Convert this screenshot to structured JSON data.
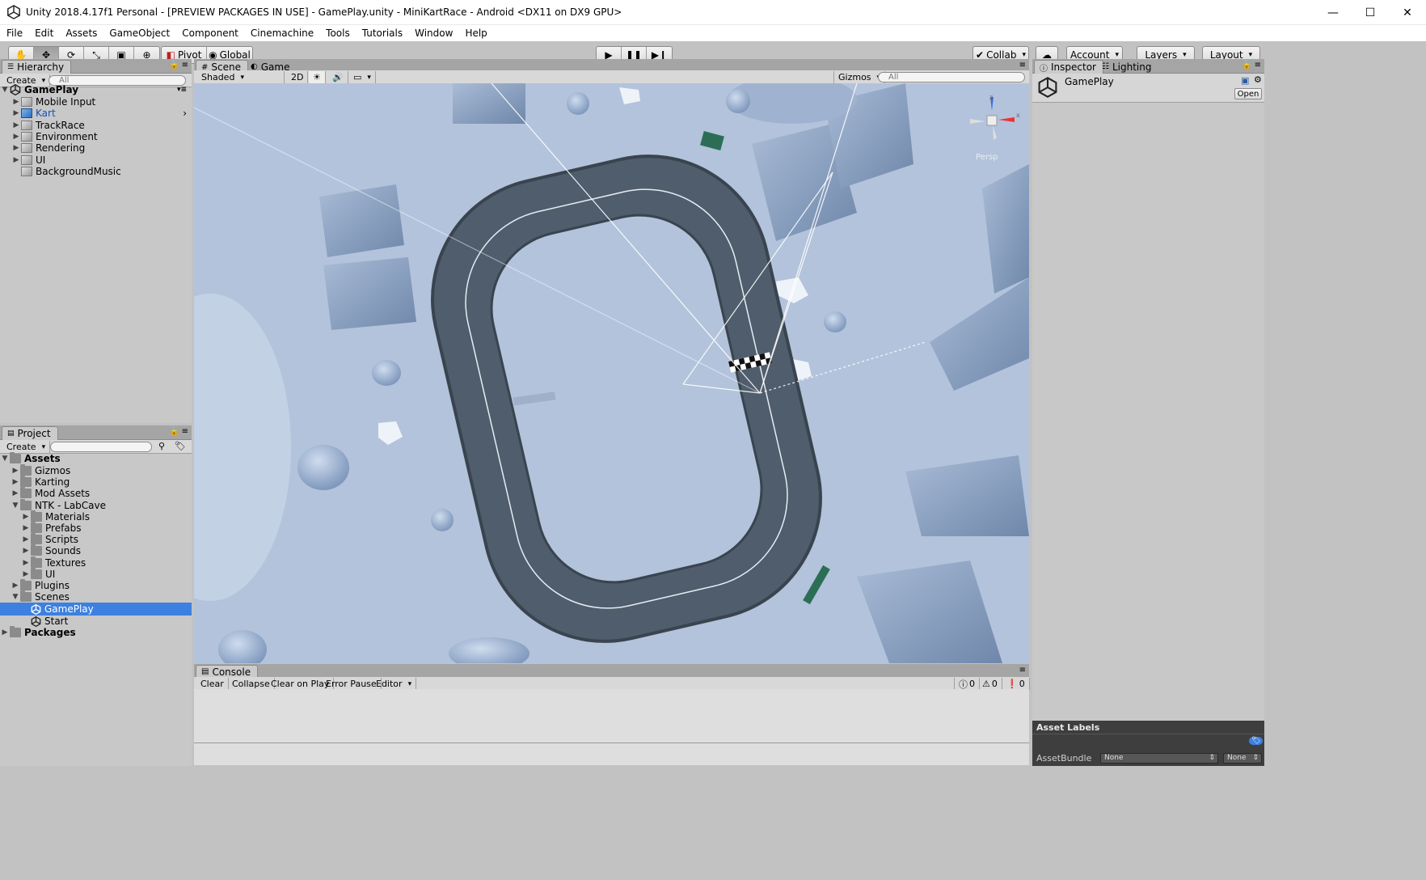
{
  "window": {
    "title": "Unity 2018.4.17f1 Personal - [PREVIEW PACKAGES IN USE] - GamePlay.unity - MiniKartRace - Android <DX11 on DX9 GPU>",
    "minimize": "—",
    "maximize": "☐",
    "close": "✕"
  },
  "menu": [
    "File",
    "Edit",
    "Assets",
    "GameObject",
    "Component",
    "Cinemachine",
    "Tools",
    "Tutorials",
    "Window",
    "Help"
  ],
  "toolbar": {
    "pivot": "Pivot",
    "global": "Global",
    "collab": "Collab",
    "account": "Account",
    "layers": "Layers",
    "layout": "Layout"
  },
  "hierarchy": {
    "tab": "Hierarchy",
    "create": "Create",
    "search_placeholder": "All",
    "scene": "GamePlay",
    "items": [
      {
        "label": "Mobile Input",
        "expandable": true,
        "color": "#000000"
      },
      {
        "label": "Kart",
        "expandable": true,
        "color": "#1a4fb0"
      },
      {
        "label": "TrackRace",
        "expandable": true,
        "color": "#000000"
      },
      {
        "label": "Environment",
        "expandable": true,
        "color": "#000000"
      },
      {
        "label": "Rendering",
        "expandable": true,
        "color": "#000000"
      },
      {
        "label": "UI",
        "expandable": true,
        "color": "#000000"
      },
      {
        "label": "BackgroundMusic",
        "expandable": false,
        "color": "#000000"
      }
    ]
  },
  "project": {
    "tab": "Project",
    "create": "Create",
    "assets_root": "Assets",
    "items": [
      {
        "label": "Gizmos",
        "depth": 1,
        "arrow": "▶"
      },
      {
        "label": "Karting",
        "depth": 1,
        "arrow": "▶"
      },
      {
        "label": "Mod Assets",
        "depth": 1,
        "arrow": "▶"
      },
      {
        "label": "NTK - LabCave",
        "depth": 1,
        "arrow": "▼"
      },
      {
        "label": "Materials",
        "depth": 2,
        "arrow": "▶"
      },
      {
        "label": "Prefabs",
        "depth": 2,
        "arrow": "▶"
      },
      {
        "label": "Scripts",
        "depth": 2,
        "arrow": "▶"
      },
      {
        "label": "Sounds",
        "depth": 2,
        "arrow": "▶"
      },
      {
        "label": "Textures",
        "depth": 2,
        "arrow": "▶"
      },
      {
        "label": "UI",
        "depth": 2,
        "arrow": "▶"
      },
      {
        "label": "Plugins",
        "depth": 1,
        "arrow": "▶"
      },
      {
        "label": "Scenes",
        "depth": 1,
        "arrow": "▼"
      }
    ],
    "scene_items": [
      "GamePlay",
      "Start"
    ],
    "packages_root": "Packages"
  },
  "scene_view": {
    "tabs": [
      "Scene",
      "Game"
    ],
    "shading": "Shaded",
    "mode_2d": "2D",
    "gizmos": "Gizmos",
    "search_placeholder": "All",
    "persp": "Persp"
  },
  "console": {
    "tab": "Console",
    "buttons": [
      "Clear",
      "Collapse",
      "Clear on Play",
      "Error Pause",
      "Editor"
    ],
    "info_count": "0",
    "warning_count": "0",
    "error_count": "0"
  },
  "inspector": {
    "tabs": [
      "Inspector",
      "Lighting"
    ],
    "object_name": "GamePlay",
    "open_button": "Open",
    "asset_labels": "Asset Labels",
    "asset_bundle_label": "AssetBundle",
    "asset_bundle_value": "None",
    "asset_variant_value": "None"
  },
  "colors": {
    "selection": "#3d80df",
    "scene_bg": "#b4c4dc",
    "track": "#4f5d6c"
  }
}
